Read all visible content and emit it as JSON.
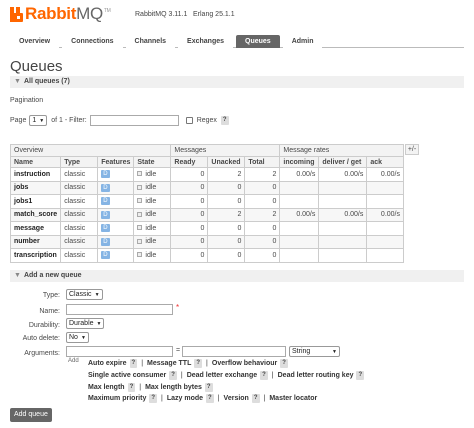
{
  "header": {
    "logo_bold": "Rabbit",
    "logo_rest": "MQ",
    "logo_tm": "TM",
    "version": "RabbitMQ 3.11.1",
    "erlang": "Erlang 25.1.1"
  },
  "tabs": [
    {
      "label": "Overview",
      "active": false
    },
    {
      "label": "Connections",
      "active": false
    },
    {
      "label": "Channels",
      "active": false
    },
    {
      "label": "Exchanges",
      "active": false
    },
    {
      "label": "Queues",
      "active": true
    },
    {
      "label": "Admin",
      "active": false
    }
  ],
  "page_title": "Queues",
  "all_queues": {
    "label": "All queues (7)"
  },
  "pagination": {
    "title": "Pagination",
    "page_label": "Page",
    "page_value": "1",
    "of_label": "of 1",
    "filter_label": "- Filter:",
    "filter_value": "",
    "regex_label": "Regex",
    "help": "?"
  },
  "table": {
    "group_headers": [
      "Overview",
      "Messages",
      "Message rates"
    ],
    "columns_toggle": "+/-",
    "headers": [
      "Name",
      "Type",
      "Features",
      "State",
      "Ready",
      "Unacked",
      "Total",
      "incoming",
      "deliver / get",
      "ack"
    ],
    "rows": [
      {
        "name": "instruction",
        "type": "classic",
        "feature": "D",
        "state": "idle",
        "ready": "0",
        "unacked": "2",
        "total": "2",
        "incoming": "0.00/s",
        "deliver": "0.00/s",
        "ack": "0.00/s"
      },
      {
        "name": "jobs",
        "type": "classic",
        "feature": "D",
        "state": "idle",
        "ready": "0",
        "unacked": "0",
        "total": "0",
        "incoming": "",
        "deliver": "",
        "ack": ""
      },
      {
        "name": "jobs1",
        "type": "classic",
        "feature": "D",
        "state": "idle",
        "ready": "0",
        "unacked": "0",
        "total": "0",
        "incoming": "",
        "deliver": "",
        "ack": ""
      },
      {
        "name": "match_score",
        "type": "classic",
        "feature": "D",
        "state": "idle",
        "ready": "0",
        "unacked": "2",
        "total": "2",
        "incoming": "0.00/s",
        "deliver": "0.00/s",
        "ack": "0.00/s"
      },
      {
        "name": "message",
        "type": "classic",
        "feature": "D",
        "state": "idle",
        "ready": "0",
        "unacked": "0",
        "total": "0",
        "incoming": "",
        "deliver": "",
        "ack": ""
      },
      {
        "name": "number",
        "type": "classic",
        "feature": "D",
        "state": "idle",
        "ready": "0",
        "unacked": "0",
        "total": "0",
        "incoming": "",
        "deliver": "",
        "ack": ""
      },
      {
        "name": "transcription",
        "type": "classic",
        "feature": "D",
        "state": "idle",
        "ready": "0",
        "unacked": "0",
        "total": "0",
        "incoming": "",
        "deliver": "",
        "ack": ""
      }
    ]
  },
  "add_queue": {
    "section_label": "Add a new queue",
    "type_label": "Type:",
    "type_value": "Classic",
    "name_label": "Name:",
    "name_required": "*",
    "durability_label": "Durability:",
    "durability_value": "Durable",
    "auto_delete_label": "Auto delete:",
    "auto_delete_value": "No",
    "arguments_label": "Arguments:",
    "arg_equals": "=",
    "arg_type_value": "String",
    "add_small": "Add",
    "arg_line1": [
      "Auto expire",
      "Message TTL",
      "Overflow behaviour"
    ],
    "arg_line2": [
      "Single active consumer",
      "Dead letter exchange",
      "Dead letter routing key"
    ],
    "arg_line3": [
      "Max length",
      "Max length bytes"
    ],
    "arg_line4": [
      "Maximum priority",
      "Lazy mode",
      "Version",
      "Master locator"
    ],
    "submit_label": "Add queue"
  },
  "colors": {
    "brand": "#ff6600",
    "active_tab": "#666666",
    "feature_badge": "#85b4e4"
  }
}
